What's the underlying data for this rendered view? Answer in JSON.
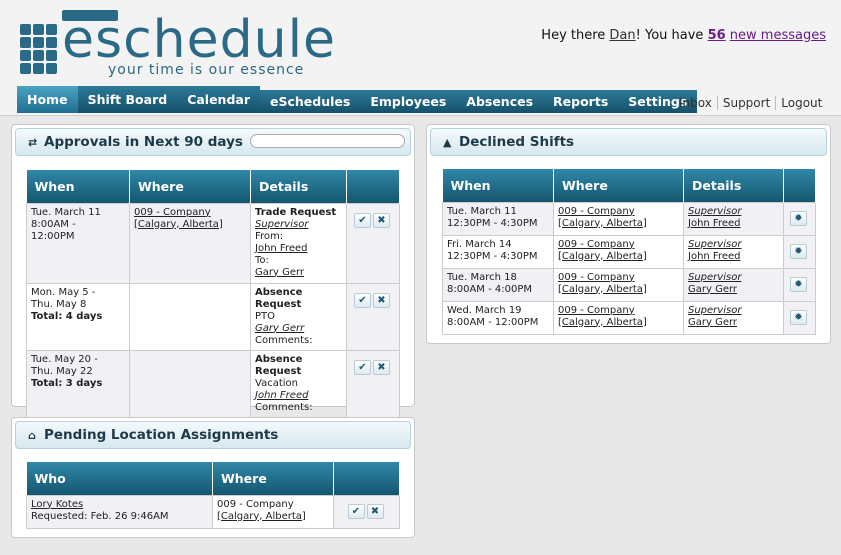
{
  "app": {
    "logo_word": "eschedule",
    "tagline": "your time is our essence"
  },
  "greeting": {
    "prefix": "Hey there ",
    "user": "Dan",
    "middle": "! You have ",
    "count": "56",
    "suffix": "new messages"
  },
  "nav": {
    "main": [
      "Home",
      "Shift Board",
      "Calendar"
    ],
    "secondary": [
      "eSchedules",
      "Employees",
      "Absences",
      "Reports",
      "Settings"
    ],
    "links": [
      "Inbox",
      "Support",
      "Logout"
    ]
  },
  "approvals": {
    "title": "Approvals in Next 90 days",
    "headers": [
      "When",
      "Where",
      "Details",
      ""
    ],
    "rows": [
      {
        "when1": "Tue. March 11",
        "when2": "8:00AM -",
        "when3": "12:00PM",
        "where1": "009 - Company",
        "where2": "[Calgary, Alberta]",
        "type": "Trade Request",
        "sub": "Supervisor",
        "l1": "From:",
        "l2": "John Freed",
        "l3": "To:",
        "l4": "Gary Gerr"
      },
      {
        "when1": "Mon. May 5 -",
        "when2": "Thu. May 8",
        "total": "Total: 4 days",
        "type": "Absence Request",
        "reason": "PTO",
        "who": "Gary Gerr",
        "comments": "Comments:"
      },
      {
        "when1": "Tue. May 20 -",
        "when2": "Thu. May 22",
        "total": "Total: 3 days",
        "type": "Absence Request",
        "reason": "Vacation",
        "who": "John Freed",
        "comments": "Comments:"
      }
    ]
  },
  "declined": {
    "title": "Declined Shifts",
    "headers": [
      "When",
      "Where",
      "Details",
      ""
    ],
    "rows": [
      {
        "when1": "Tue. March 11",
        "when2": "12:30PM - 4:30PM",
        "where1": "009 - Company",
        "where2": "[Calgary, Alberta]",
        "role": "Supervisor",
        "who": "John Freed"
      },
      {
        "when1": "Fri. March 14",
        "when2": "12:30PM - 4:30PM",
        "where1": "009 - Company",
        "where2": "[Calgary, Alberta]",
        "role": "Supervisor",
        "who": "John Freed"
      },
      {
        "when1": "Tue. March 18",
        "when2": "8:00AM - 4:00PM",
        "where1": "009 - Company",
        "where2": "[Calgary, Alberta]",
        "role": "Supervisor",
        "who": "Gary Gerr"
      },
      {
        "when1": "Wed. March 19",
        "when2": "8:00AM - 12:00PM",
        "where1": "009 - Company",
        "where2": "[Calgary, Alberta]",
        "role": "Supervisor",
        "who": "Gary Gerr"
      }
    ]
  },
  "pending": {
    "title": "Pending Location Assignments",
    "headers": [
      "Who",
      "Where",
      ""
    ],
    "rows": [
      {
        "who": "Lory Kotes",
        "requested": "Requested: Feb. 26 9:46AM",
        "where1": "009 - Company",
        "where2": "[Calgary, Alberta]"
      }
    ]
  },
  "icons": {
    "approve": "✔",
    "reject": "✖",
    "gear": "✹",
    "swap": "⇄",
    "warn": "▲",
    "home": "⌂"
  },
  "colors": {
    "brand": "#2a6a86",
    "header_grad_top": "#3088a8",
    "header_grad_bottom": "#15566f",
    "message_link": "#6a1c8a"
  }
}
